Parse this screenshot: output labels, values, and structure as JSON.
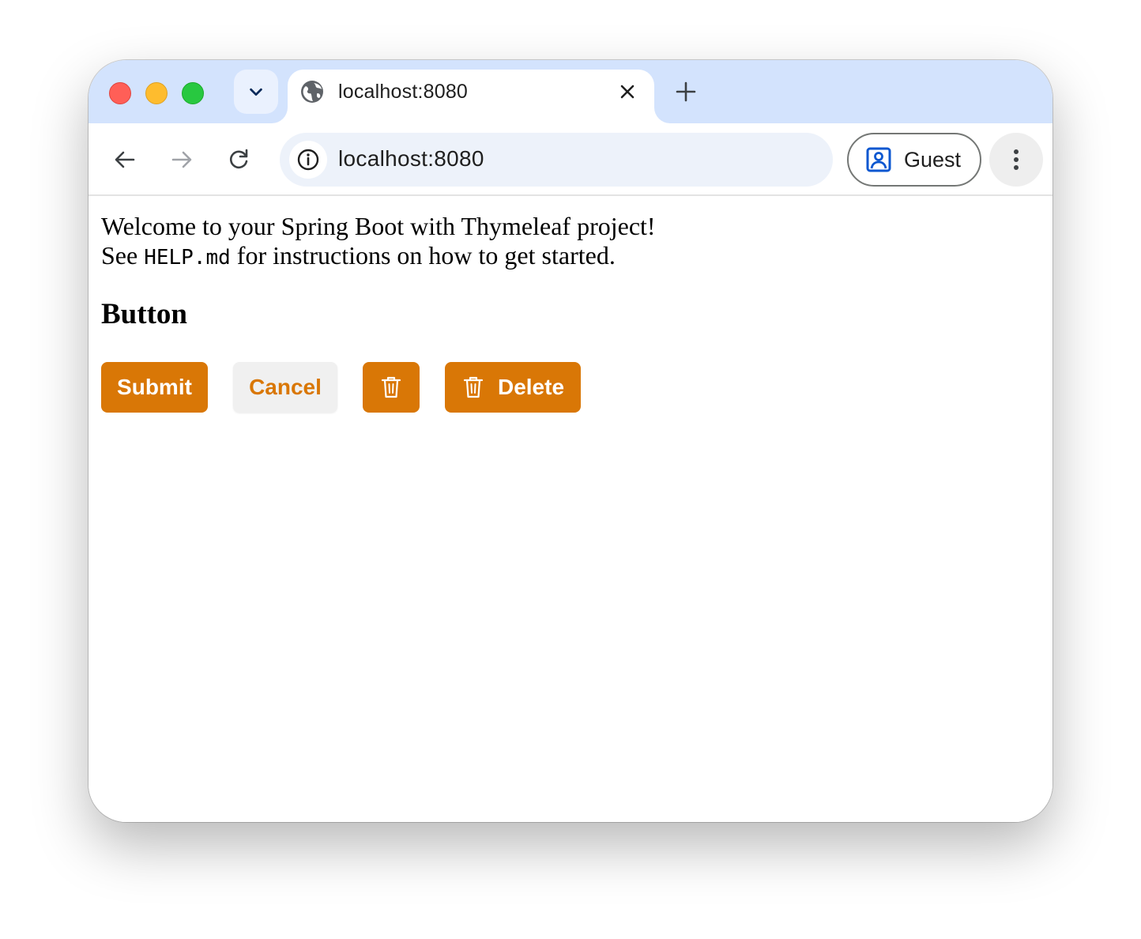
{
  "browser": {
    "tab": {
      "title": "localhost:8080"
    },
    "omnibox": {
      "url": "localhost:8080"
    },
    "profile": {
      "label": "Guest"
    }
  },
  "page": {
    "welcome_line1": "Welcome to your Spring Boot with Thymeleaf project!",
    "welcome_line2_prefix": "See ",
    "welcome_line2_code": "HELP.md",
    "welcome_line2_suffix": " for instructions on how to get started.",
    "section_heading": "Button",
    "buttons": {
      "submit": "Submit",
      "cancel": "Cancel",
      "delete": "Delete"
    }
  },
  "colors": {
    "accent": "#d97706",
    "tabstrip": "#d3e3fd",
    "omnibox": "#edf2fa"
  },
  "icons": {
    "tab_search": "chevron-down-icon",
    "favicon": "globe-icon",
    "tab_close": "close-icon",
    "new_tab": "plus-icon",
    "back": "arrow-left-icon",
    "forward": "arrow-right-icon",
    "reload": "reload-icon",
    "site_info": "info-icon",
    "profile": "person-badge-icon",
    "menu": "kebab-menu-icon",
    "trash": "trash-icon"
  }
}
